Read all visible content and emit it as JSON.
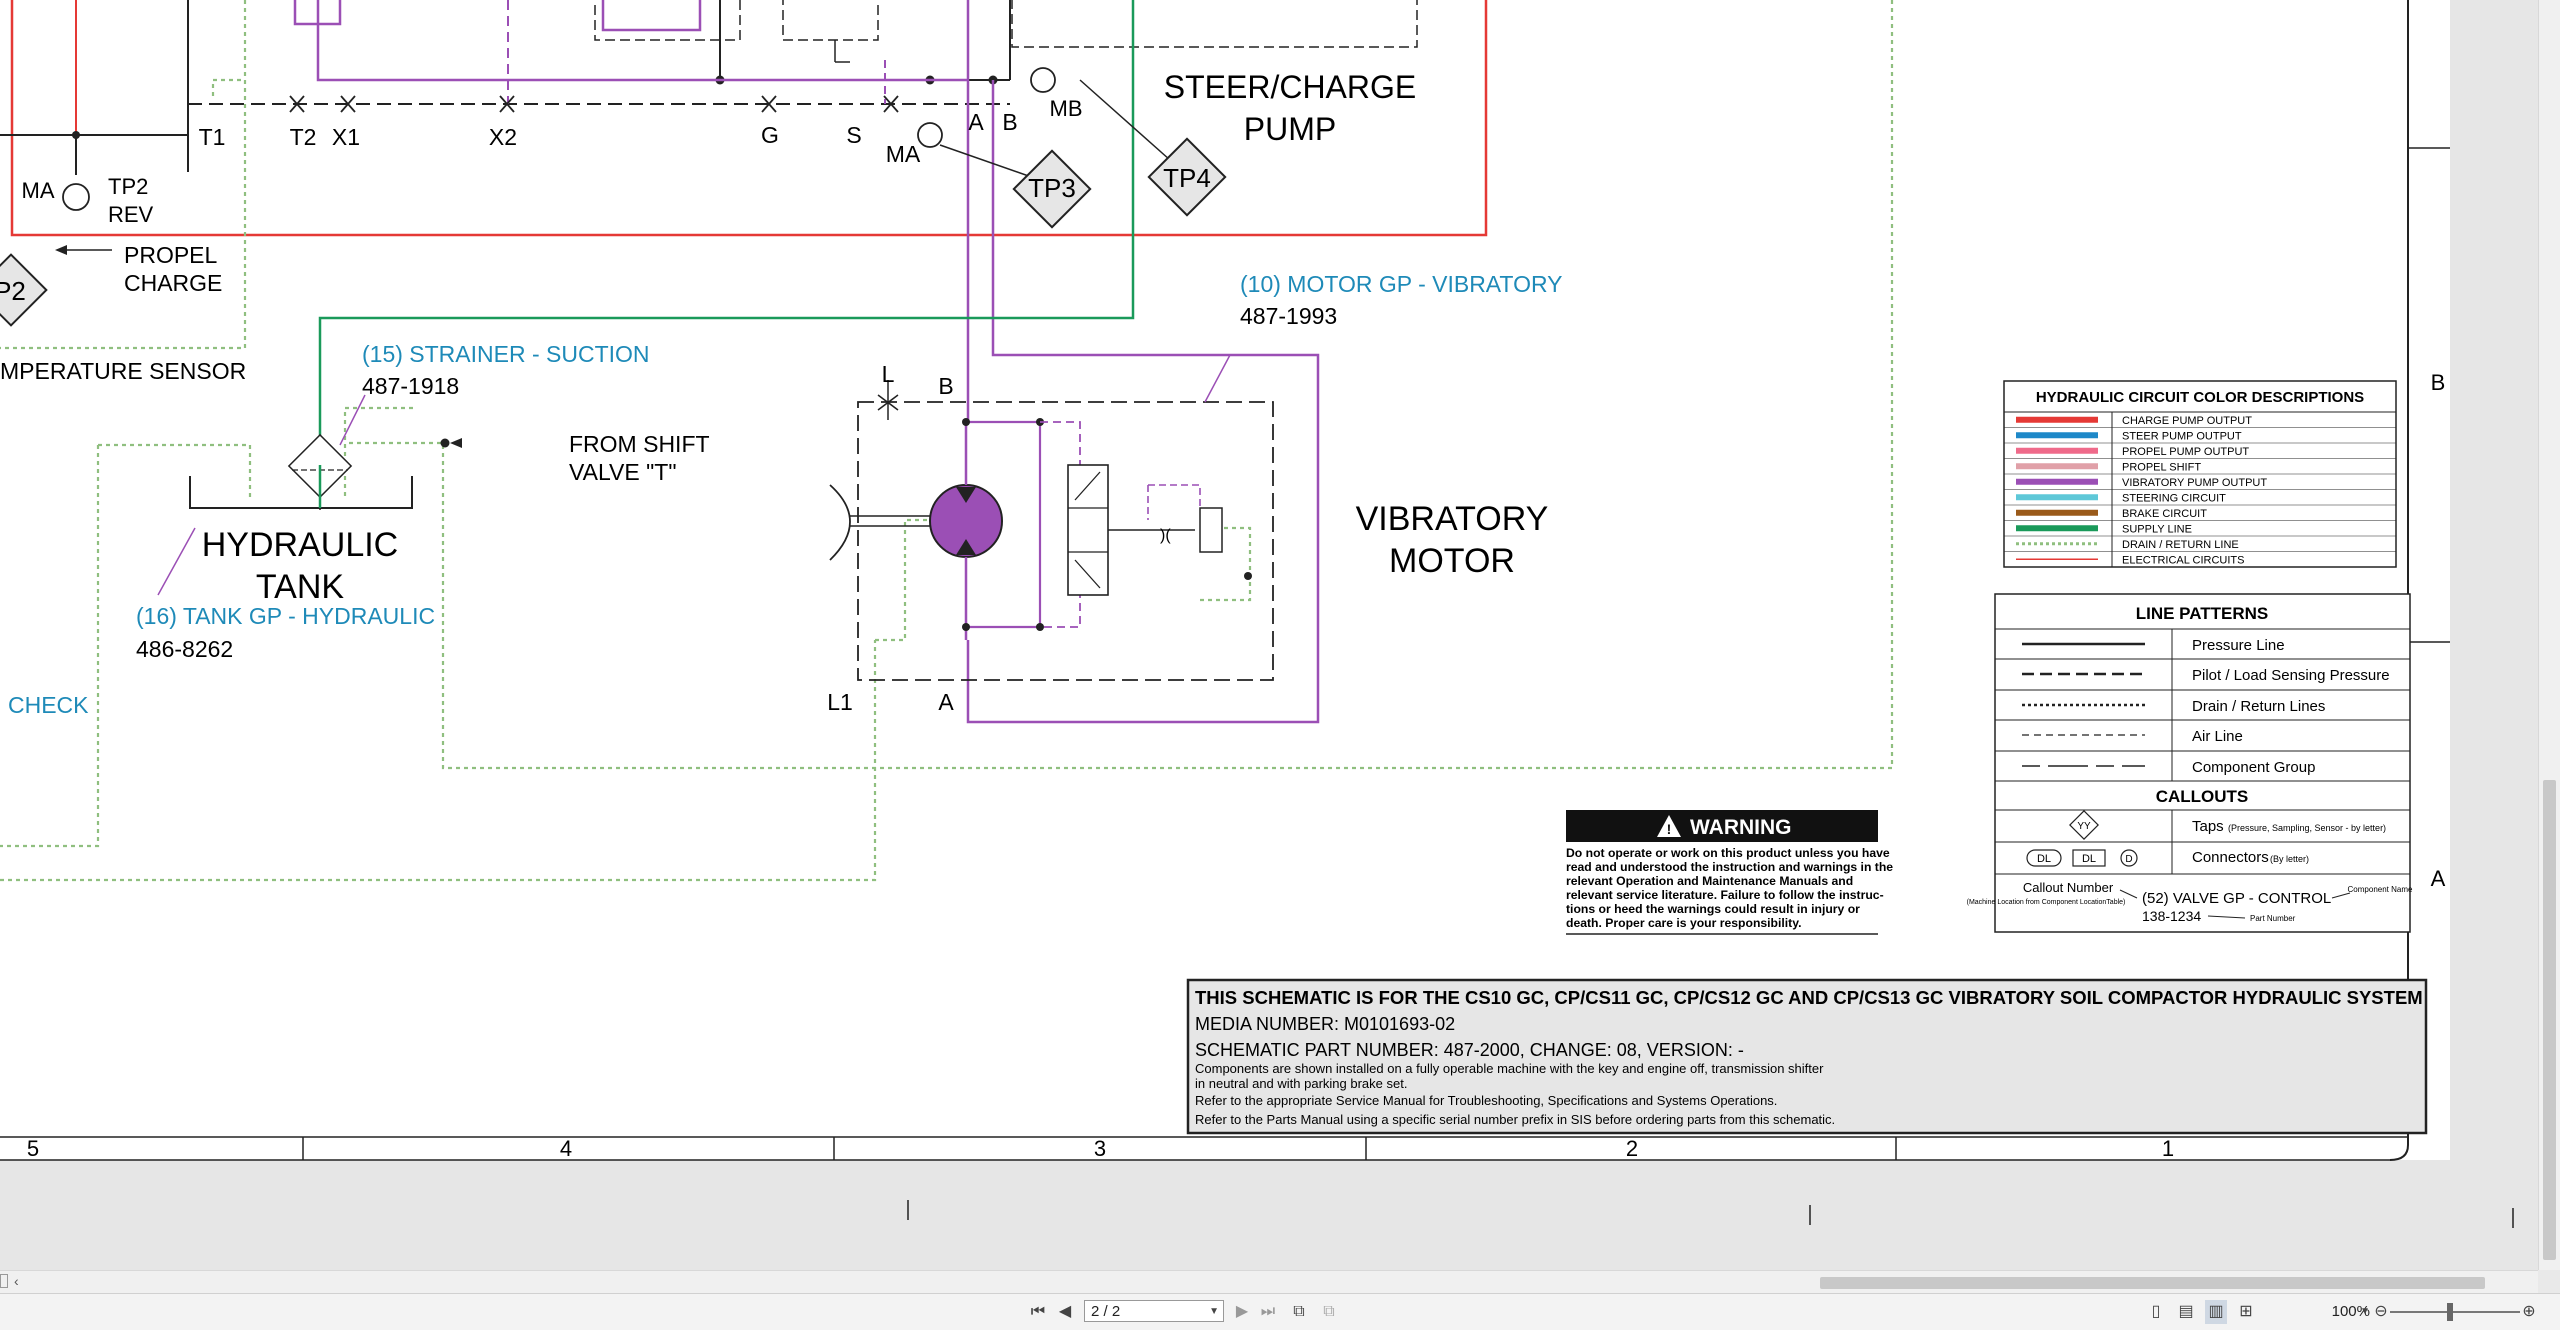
{
  "schematic": {
    "test_points": [
      "T1",
      "T2",
      "X1",
      "X2",
      "G",
      "S",
      "A",
      "B",
      "MB",
      "MA"
    ],
    "tp_badges": [
      "TP3",
      "TP4",
      "P2"
    ],
    "pump_title_line1": "STEER/CHARGE",
    "pump_title_line2": "PUMP",
    "ma_label": "MA",
    "tp2_label": "TP2",
    "rev_label": "REV",
    "propel_line1": "PROPEL",
    "propel_line2": "CHARGE",
    "temp_sensor": "MPERATURE SENSOR",
    "strainer_callout": "(15) STRAINER -  SUCTION",
    "strainer_part": "487-1918",
    "from_shift_line1": "FROM SHIFT",
    "from_shift_line2": "VALVE \"T\"",
    "tank_line1": "HYDRAULIC",
    "tank_line2": "TANK",
    "tank_callout": "(16) TANK GP -  HYDRAULIC",
    "tank_part": "486-8262",
    "check_label": "CHECK",
    "motor_callout": "(10) MOTOR GP -  VIBRATORY",
    "motor_part": "487-1993",
    "motor_port_l": "L",
    "motor_port_b": "B",
    "motor_port_l1": "L1",
    "motor_port_a": "A",
    "motor_title_line1": "VIBRATORY",
    "motor_title_line2": "MOTOR",
    "zone_letters": [
      "B",
      "A"
    ],
    "column_numbers": [
      "5",
      "4",
      "3",
      "2",
      "1"
    ]
  },
  "color_legend": {
    "title": "HYDRAULIC CIRCUIT COLOR DESCRIPTIONS",
    "items": [
      {
        "label": "CHARGE PUMP OUTPUT",
        "color": "#e53935",
        "style": "solid"
      },
      {
        "label": "STEER PUMP OUTPUT",
        "color": "#1e88c8",
        "style": "solid"
      },
      {
        "label": "PROPEL PUMP OUTPUT",
        "color": "#ef6a8a",
        "style": "solid"
      },
      {
        "label": "PROPEL SHIFT",
        "color": "#e0a0a8",
        "style": "solid"
      },
      {
        "label": "VIBRATORY PUMP OUTPUT",
        "color": "#9b4fb5",
        "style": "solid"
      },
      {
        "label": "STEERING CIRCUIT",
        "color": "#5ec8d8",
        "style": "solid"
      },
      {
        "label": "BRAKE CIRCUIT",
        "color": "#9a5a1a",
        "style": "solid"
      },
      {
        "label": "SUPPLY LINE",
        "color": "#1a9a5a",
        "style": "solid"
      },
      {
        "label": "DRAIN / RETURN LINE",
        "color": "#8fbf7f",
        "style": "dotted"
      },
      {
        "label": "ELECTRICAL CIRCUITS",
        "color": "#e53935",
        "style": "thin"
      }
    ]
  },
  "line_patterns": {
    "title": "LINE PATTERNS",
    "items": [
      "Pressure Line",
      "Pilot / Load Sensing Pressure",
      "Drain / Return Lines",
      "Air Line",
      "Component Group"
    ],
    "callouts_title": "CALLOUTS",
    "taps_symbol": "YY",
    "taps_label": "Taps",
    "taps_note": "(Pressure, Sampling, Sensor - by letter)",
    "connector_symbols": [
      "DL",
      "DL",
      "D"
    ],
    "connectors_label": "Connectors",
    "connectors_note": "(By letter)",
    "callout_number_label": "Callout Number",
    "callout_number_note": "(Machine Location from Component LocationTable)",
    "callout_example": "(52) VALVE GP - CONTROL",
    "callout_example_part": "138-1234",
    "component_name_label": "Component Name",
    "part_number_label": "Part Number"
  },
  "warning": {
    "title": "WARNING",
    "lines": [
      "Do not operate or work on this product unless you have",
      "read and understood the instruction and warnings in the",
      "relevant Operation and Maintenance Manuals and",
      "relevant service literature. Failure to follow the instruc-",
      "tions or heed the warnings could result in injury or",
      "death. Proper care is your responsibility."
    ]
  },
  "title_block": {
    "heading": "THIS SCHEMATIC IS FOR THE CS10 GC, CP/CS11 GC, CP/CS12 GC AND CP/CS13 GC VIBRATORY SOIL COMPACTOR HYDRAULIC SYSTEM",
    "media_number": "MEDIA NUMBER: M0101693-02",
    "part_number": "SCHEMATIC PART NUMBER: 487-2000, CHANGE: 08, VERSION: -",
    "notes": [
      "Components are shown installed on a fully operable machine with the key and engine off, transmission shifter",
      "in neutral and with parking brake set.",
      "Refer to the appropriate Service Manual for Troubleshooting, Specifications and Systems Operations.",
      "Refer to the Parts Manual using a specific serial number prefix in SIS before ordering parts from this schematic."
    ]
  },
  "viewer": {
    "page_indicator": "2 / 2",
    "zoom": "100%",
    "colors": {
      "bg": "#e6e6e6",
      "toolbar": "#f3f3f3"
    }
  }
}
